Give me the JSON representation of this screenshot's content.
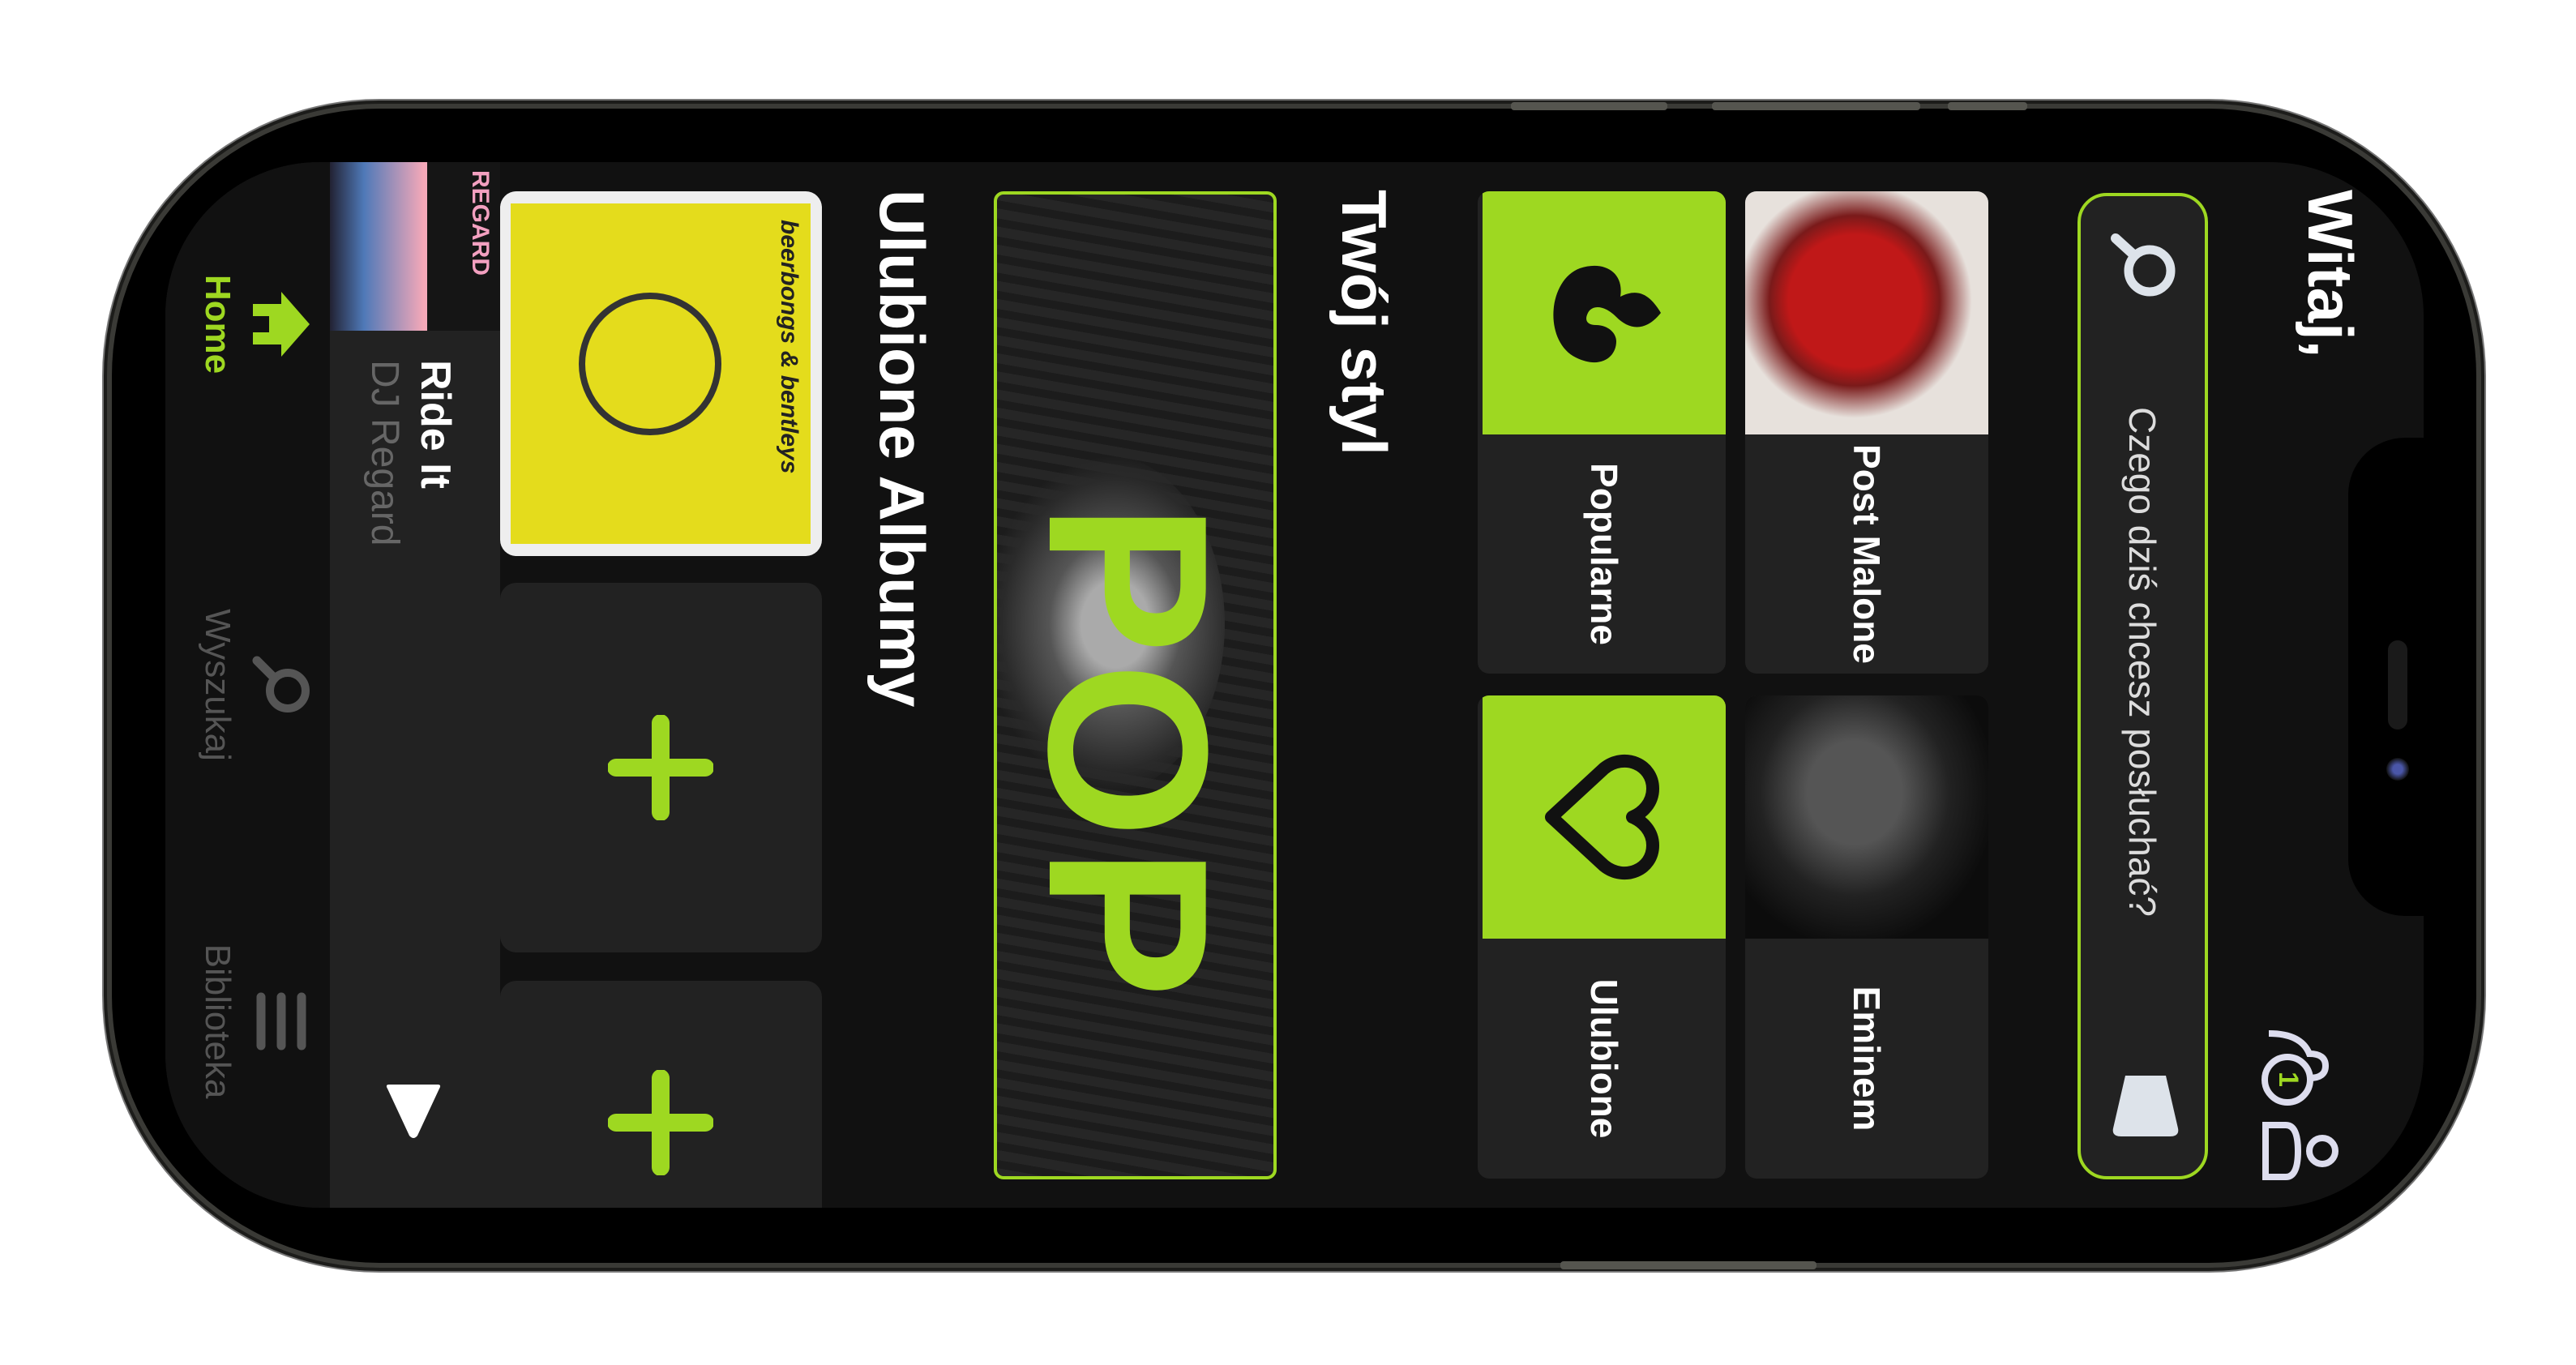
{
  "header": {
    "greeting": "Witaj,",
    "notification_count": "1"
  },
  "search": {
    "placeholder": "Czego dziś chcesz posłuchać?"
  },
  "tiles": [
    {
      "label": "Post Malone",
      "type": "artist"
    },
    {
      "label": "Eminem",
      "type": "artist"
    },
    {
      "label": "Popularne",
      "icon": "flame-icon"
    },
    {
      "label": "Ulubione",
      "icon": "heart-icon"
    }
  ],
  "style_section": {
    "title": "Twój styl",
    "banner_text": "POP"
  },
  "albums_section": {
    "title": "Ulubione Albumy",
    "album_cover_text": "beerbongs & bentleys"
  },
  "player": {
    "title": "Ride It",
    "artist": "DJ Regard",
    "cover_text": "REGARD"
  },
  "tabs": [
    {
      "label": "Home",
      "icon": "home-icon",
      "active": true
    },
    {
      "label": "Wyszukaj",
      "icon": "search-icon",
      "active": false
    },
    {
      "label": "Biblioteka",
      "icon": "library-icon",
      "active": false
    }
  ],
  "colors": {
    "accent": "#9ed821",
    "background": "#111111",
    "card": "#222222"
  }
}
